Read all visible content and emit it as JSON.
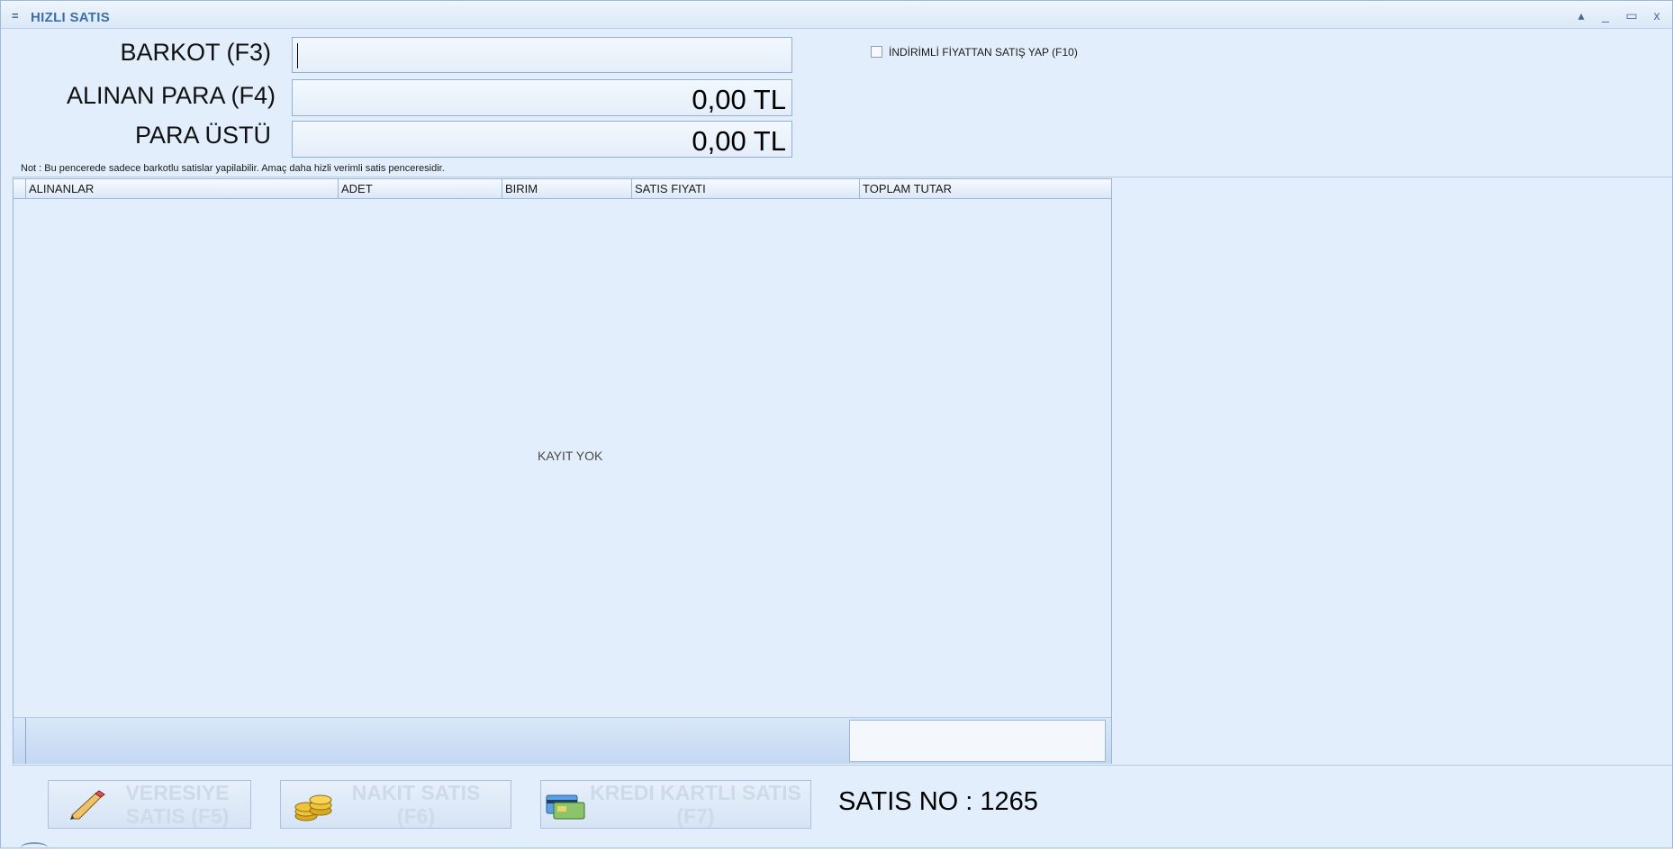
{
  "window": {
    "menu_glyph": "=",
    "title": "HIZLI SATIS",
    "controls": {
      "up": "▴",
      "minimize": "_",
      "maximize": "▭",
      "close": "x"
    }
  },
  "form": {
    "barcode_label": "BARKOT (F3)",
    "barcode_value": "",
    "received_label": "ALINAN PARA (F4)",
    "received_value": "0,00 TL",
    "change_label": "PARA ÜSTÜ",
    "change_value": "0,00 TL",
    "discount_checkbox_label": "İNDİRİMLİ FİYATTAN SATIŞ YAP (F10)",
    "discount_checked": false,
    "note": "Not : Bu pencerede sadece  barkotlu satislar yapilabilir. Amaç daha hizli verimli satis penceresidir."
  },
  "grid": {
    "columns": [
      "ALINANLAR",
      "ADET",
      "BIRIM",
      "SATIS FIYATI",
      "TOPLAM TUTAR"
    ],
    "empty_message": "KAYIT YOK",
    "footer_value": ""
  },
  "actions": {
    "credit_sale": "VERESIYE SATIS (F5)",
    "credit_sale_line1": "VERESIYE",
    "credit_sale_line2": "SATIS (F5)",
    "cash_sale": "NAKIT SATIS (F6)",
    "cash_sale_line1": "NAKIT SATIS",
    "cash_sale_line2": "(F6)",
    "card_sale": "KREDI KARTLI SATIS (F7)",
    "card_sale_line1": "KREDI KARTLI SATIS",
    "card_sale_line2": "(F7)",
    "sale_number": "SATIS NO : 1265"
  },
  "icons": {
    "credit_sale": "pencil-icon",
    "cash_sale": "coins-icon",
    "card_sale": "credit-card-icon"
  },
  "colors": {
    "window_bg": "#e2eefb",
    "title_text": "#3c6fa8",
    "disabled_button_text": "#ccdaea"
  }
}
